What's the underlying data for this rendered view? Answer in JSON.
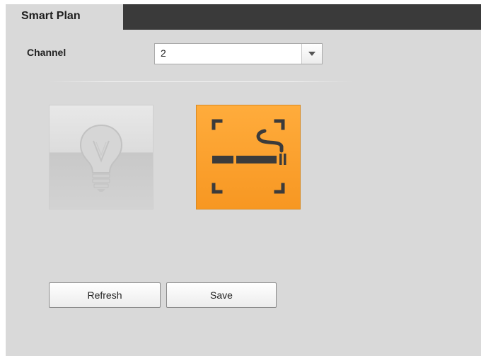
{
  "tabs": [
    {
      "label": "Smart Plan",
      "active": true
    }
  ],
  "channel": {
    "label": "Channel",
    "selected": "2"
  },
  "plans": [
    {
      "name": "illumination",
      "icon": "lightbulb-icon",
      "active": false
    },
    {
      "name": "smoke-detection",
      "icon": "cigarette-icon",
      "active": true,
      "color": "#f79722"
    }
  ],
  "buttons": {
    "refresh_label": "Refresh",
    "save_label": "Save"
  }
}
